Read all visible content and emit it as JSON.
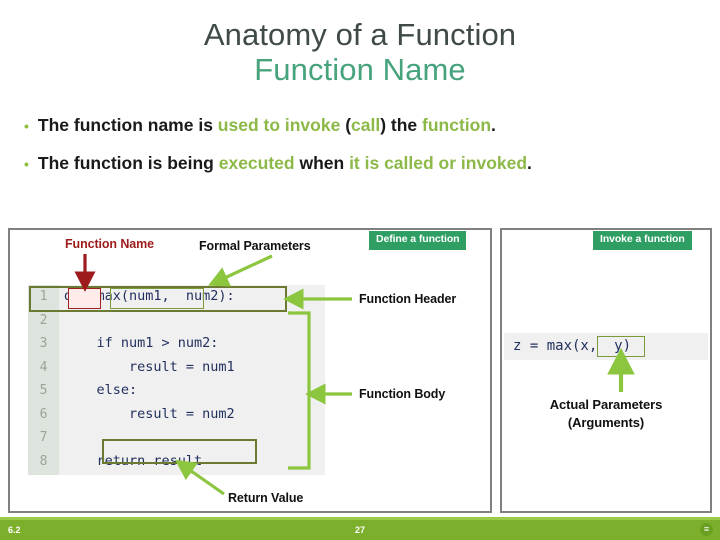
{
  "title": {
    "line1": "Anatomy of a Function",
    "line2": "Function Name",
    "color_line1": "#404b49",
    "color_line2": "#47a37c"
  },
  "bullets": [
    {
      "segments": [
        {
          "text": "The function name is ",
          "style": "dark"
        },
        {
          "text": "used to invoke ",
          "style": "green"
        },
        {
          "text": "(",
          "style": "dark"
        },
        {
          "text": "call",
          "style": "green"
        },
        {
          "text": ") the ",
          "style": "dark"
        },
        {
          "text": "function",
          "style": "green"
        },
        {
          "text": ".",
          "style": "dark"
        }
      ]
    },
    {
      "segments": [
        {
          "text": "The function is being ",
          "style": "dark"
        },
        {
          "text": "executed ",
          "style": "green"
        },
        {
          "text": "when ",
          "style": "dark"
        },
        {
          "text": "it is called or invoked",
          "style": "green"
        },
        {
          "text": ".",
          "style": "dark"
        }
      ]
    }
  ],
  "bullet_marker": "•",
  "panels": {
    "left": {
      "badge": "Define a function",
      "labels": {
        "function_name": "Function Name",
        "formal_parameters": "Formal Parameters",
        "function_header": "Function Header",
        "function_body": "Function Body",
        "return_value": "Return Value"
      },
      "code": {
        "line_numbers": [
          "1",
          "2",
          "3",
          "4",
          "5",
          "6",
          "7",
          "8"
        ],
        "lines": [
          "def max(num1, num2):",
          "",
          "    if num1 > num2:",
          "        result = num1",
          "    else:",
          "        result = num2",
          "",
          "    return result"
        ],
        "header_tokens": {
          "def": "def ",
          "name": "max",
          "open_paren": "(",
          "params": "num1,  num2",
          "close_paren": ")",
          "colon": ":"
        },
        "return_statement": "return result"
      }
    },
    "right": {
      "badge": "Invoke a function",
      "code": {
        "prefix": "z = max(",
        "arguments": "x,  y",
        "suffix": ")"
      },
      "labels": {
        "actual_parameters_line1": "Actual Parameters",
        "actual_parameters_line2": "(Arguments)"
      }
    }
  },
  "colors": {
    "badge_green": "#2f9e63",
    "arrow_green": "#8cc63f",
    "arrow_red": "#9e1b1b",
    "box_olive": "#6b7a32",
    "box_red": "#a02020",
    "footer_green": "#7cb02c",
    "code_bg": "#f0f0f0",
    "gutter_bg": "#dde4dd",
    "code_text": "#22305e"
  },
  "footer": {
    "section": "6.2",
    "page": "27",
    "icon": "menu-icon",
    "icon_glyph": "≡"
  }
}
